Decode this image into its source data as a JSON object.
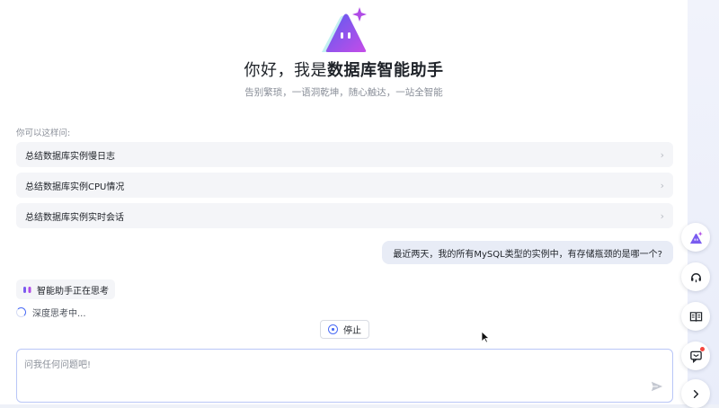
{
  "header": {
    "greeting": "你好，我是",
    "name": "数据库智能助手",
    "subtitle": "告别繁琐，一语洞乾坤，随心触达，一站全智能"
  },
  "suggestions": {
    "hint": "你可以这样问:",
    "items": [
      {
        "label": "总结数据库实例慢日志",
        "chevron": "›"
      },
      {
        "label": "总结数据库实例CPU情况",
        "chevron": "›"
      },
      {
        "label": "总结数据库实例实时会话",
        "chevron": "›"
      }
    ]
  },
  "conversation": {
    "user_message": "最近两天，我的所有MySQL类型的实例中，有存储瓶颈的是哪一个?",
    "assistant_status": "智能助手正在思考",
    "deep_thinking": "深度思考中...",
    "stop_label": "停止"
  },
  "input": {
    "placeholder": "问我任何问题吧!"
  },
  "rail": {
    "buttons": [
      {
        "icon": "assistant-logo-icon"
      },
      {
        "icon": "headset-support-icon"
      },
      {
        "icon": "book-icon"
      },
      {
        "icon": "message-notification-icon",
        "badge": true
      },
      {
        "icon": "chevron-right-icon"
      }
    ]
  },
  "colors": {
    "accent": "#4b6cf5",
    "logo_gradient_start": "#5b5cf0",
    "logo_gradient_end": "#c54ce8",
    "notification": "#f5463f"
  }
}
